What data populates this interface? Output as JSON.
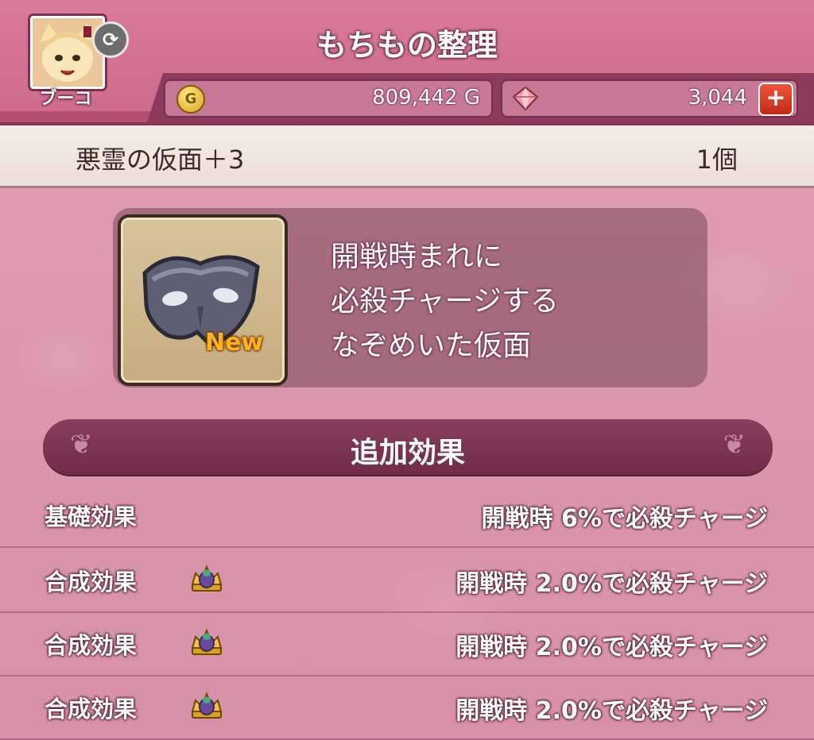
{
  "header": {
    "title": "もちもの整理",
    "player_name": "ブーコ",
    "gold": "809,442 G",
    "gems": "3,044"
  },
  "item": {
    "name": "悪霊の仮面＋3",
    "count": "1個",
    "badge": "New",
    "description_lines": [
      "開戦時まれに",
      "必殺チャージする",
      "なぞめいた仮面"
    ]
  },
  "effects": {
    "section_title": "追加効果",
    "rows": [
      {
        "label": "基礎効果",
        "value": "開戦時  6%で必殺チャージ",
        "icon": ""
      },
      {
        "label": "合成効果",
        "value": "開戦時  2.0%で必殺チャージ",
        "icon": "crown-icon"
      },
      {
        "label": "合成効果",
        "value": "開戦時  2.0%で必殺チャージ",
        "icon": "crown-icon"
      },
      {
        "label": "合成効果",
        "value": "開戦時  2.0%で必殺チャージ",
        "icon": "crown-icon"
      }
    ]
  },
  "icons": {
    "avatar": "player-avatar",
    "swap": "swap-icon",
    "gold": "gold-coin-icon",
    "gem": "gem-icon",
    "plus": "plus-icon",
    "item": "mask-icon"
  }
}
